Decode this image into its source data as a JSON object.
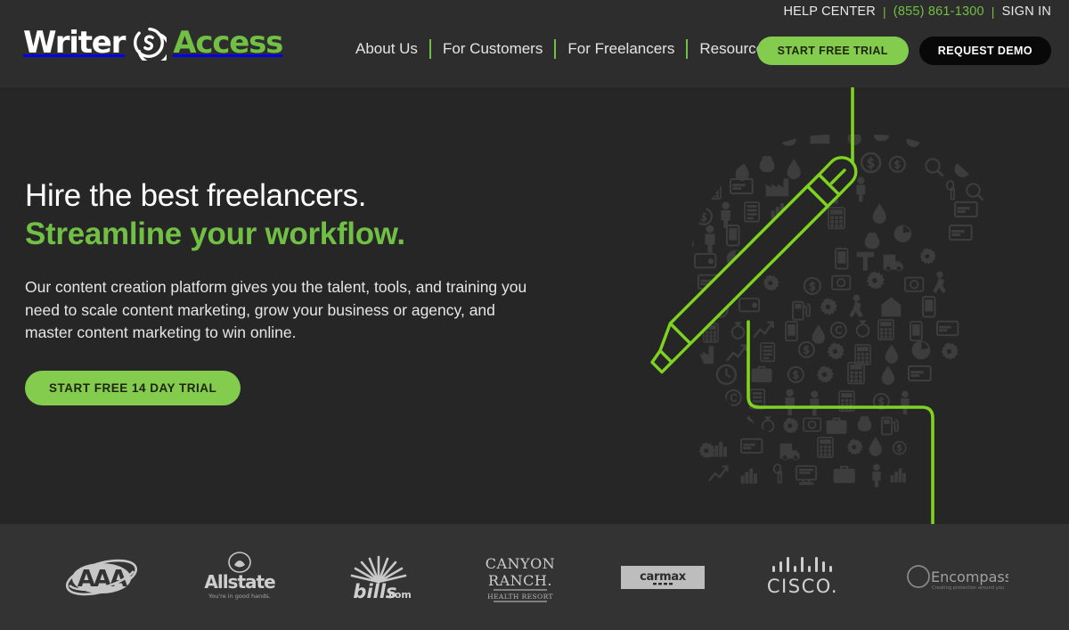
{
  "brand": {
    "name_part1": "Writer",
    "name_part2": "Access",
    "mark_icon": "circle-s-icon",
    "colors": {
      "green": "#71bf44",
      "button_green": "#84cc4e",
      "header_bg": "#2d2d2d",
      "hero_bg": "#262626",
      "band_bg": "#333333"
    }
  },
  "utility": {
    "help_center": "HELP CENTER",
    "sep1": "|",
    "phone": "(855) 861-1300",
    "sep2": "|",
    "sign_in": "SIGN IN"
  },
  "nav": {
    "items": [
      {
        "label": "About Us"
      },
      {
        "label": "For Customers"
      },
      {
        "label": "For Freelancers"
      },
      {
        "label": "Resources"
      }
    ]
  },
  "header_ctas": {
    "trial": "START FREE TRIAL",
    "demo": "REQUEST DEMO"
  },
  "hero": {
    "headline_line1": "Hire the best freelancers.",
    "headline_line2": "Streamline your workflow.",
    "subtext": "Our content creation platform gives you the talent, tools, and training you need to scale content marketing, grow your business or agency, and master content marketing to win online.",
    "cta": "START FREE 14 DAY TRIAL",
    "art_icon": "head-of-icons-with-pen-illustration"
  },
  "logos": {
    "items": [
      {
        "name": "aaa-logo",
        "text": "AAA",
        "tagline": ""
      },
      {
        "name": "allstate-logo",
        "text": "Allstate",
        "tagline": "You're in good hands."
      },
      {
        "name": "bills-com-logo",
        "text": "bills",
        "tagline": ".com"
      },
      {
        "name": "canyon-ranch-logo",
        "text": "CANYON RANCH",
        "tagline": "HEALTH RESORT"
      },
      {
        "name": "carmax-logo",
        "text": "carmax",
        "tagline": ""
      },
      {
        "name": "cisco-logo",
        "text": "CISCO",
        "tagline": ""
      },
      {
        "name": "encompass-logo",
        "text": "Encompass",
        "tagline": "Creating protection around you"
      }
    ]
  }
}
